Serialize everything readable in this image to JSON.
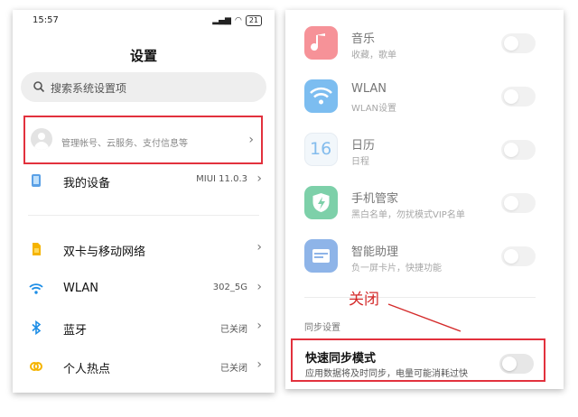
{
  "left": {
    "status": {
      "time": "15:57",
      "battery": "21"
    },
    "title": "设置",
    "search": {
      "placeholder": "搜索系统设置项"
    },
    "account": {
      "subtitle": "管理帐号、云服务、支付信息等"
    },
    "items": [
      {
        "label": "我的设备",
        "value": "MIUI 11.0.3"
      },
      {
        "label": "双卡与移动网络",
        "value": ""
      },
      {
        "label": "WLAN",
        "value": "302_5G"
      },
      {
        "label": "蓝牙",
        "value": "已关闭"
      },
      {
        "label": "个人热点",
        "value": "已关闭"
      }
    ]
  },
  "right": {
    "apps": [
      {
        "name": "音乐",
        "sub": "收藏，歌单",
        "color": "#f0444e",
        "on": false
      },
      {
        "name": "WLAN",
        "sub": "WLAN设置",
        "color": "#1e8ee6",
        "on": false
      },
      {
        "name": "日历",
        "sub": "日程",
        "icon_text": "16",
        "color": "#e9f1f8",
        "on": false
      },
      {
        "name": "手机管家",
        "sub": "黑白名单，勿扰模式VIP名单",
        "color": "#1fae6c",
        "on": false
      },
      {
        "name": "智能助理",
        "sub": "负一屏卡片，快捷功能",
        "color": "#3d7fd8",
        "on": false
      }
    ],
    "annotation": "关闭",
    "section_label": "同步设置",
    "fast_sync": {
      "name": "快速同步模式",
      "sub": "应用数据将及时同步，电量可能消耗过快",
      "on": false
    }
  },
  "colors": {
    "highlight": "#e2313d",
    "annotation": "#d42a2a"
  }
}
